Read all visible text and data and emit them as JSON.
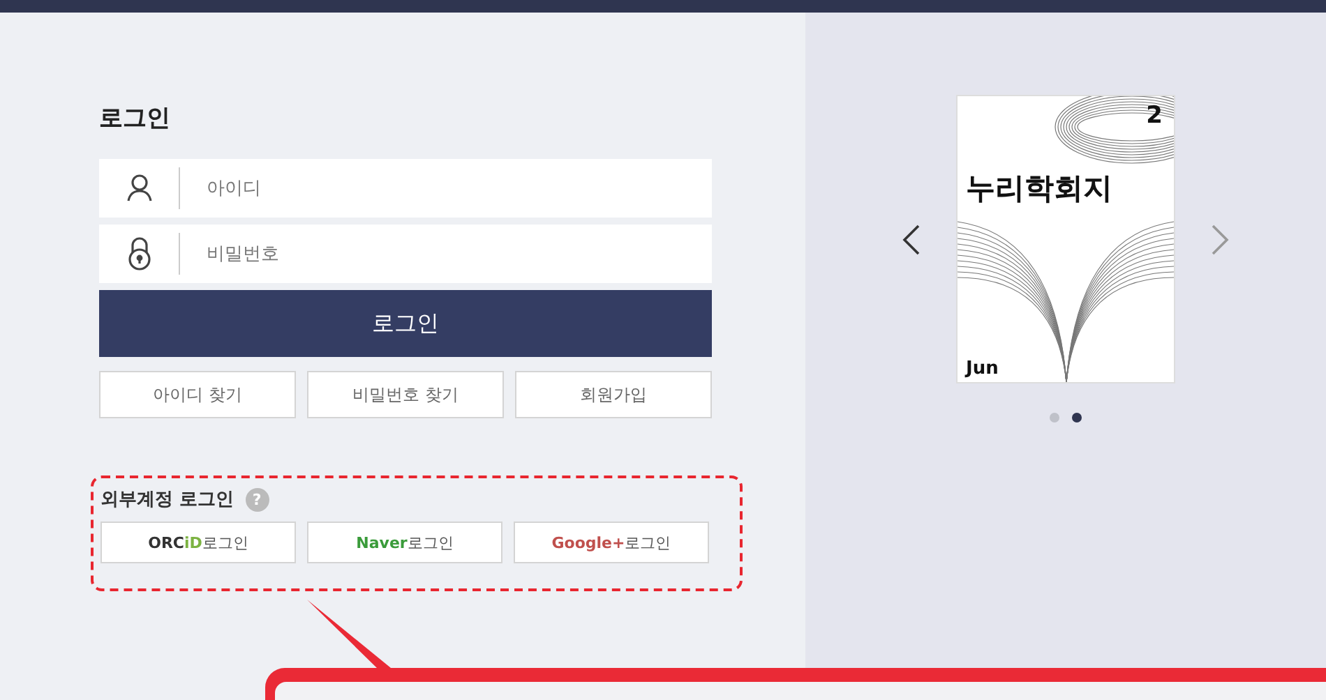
{
  "login": {
    "title": "로그인",
    "id_field": {
      "placeholder": "아이디"
    },
    "password_field": {
      "placeholder": "비밀번호"
    },
    "submit": "로그인",
    "links": [
      "아이디 찾기",
      "비밀번호 찾기",
      "회원가입"
    ]
  },
  "external": {
    "title": "외부계정 로그인",
    "help": "?",
    "providers": [
      {
        "parts": [
          {
            "text": "ORC",
            "color": "#333333"
          },
          {
            "text": "iD",
            "color": "#7cb342"
          }
        ],
        "suffix": "로그인"
      },
      {
        "parts": [
          {
            "text": "Naver",
            "color": "#3a9b3a"
          }
        ],
        "suffix": "로그인"
      },
      {
        "parts": [
          {
            "text": "Google+",
            "color": "#c0504d"
          }
        ],
        "suffix": "로그인"
      }
    ]
  },
  "carousel": {
    "cover": {
      "title": "누리학회지",
      "issue": "2",
      "month": "Jun"
    },
    "dots": [
      {
        "selected": false
      },
      {
        "selected": true
      }
    ]
  }
}
